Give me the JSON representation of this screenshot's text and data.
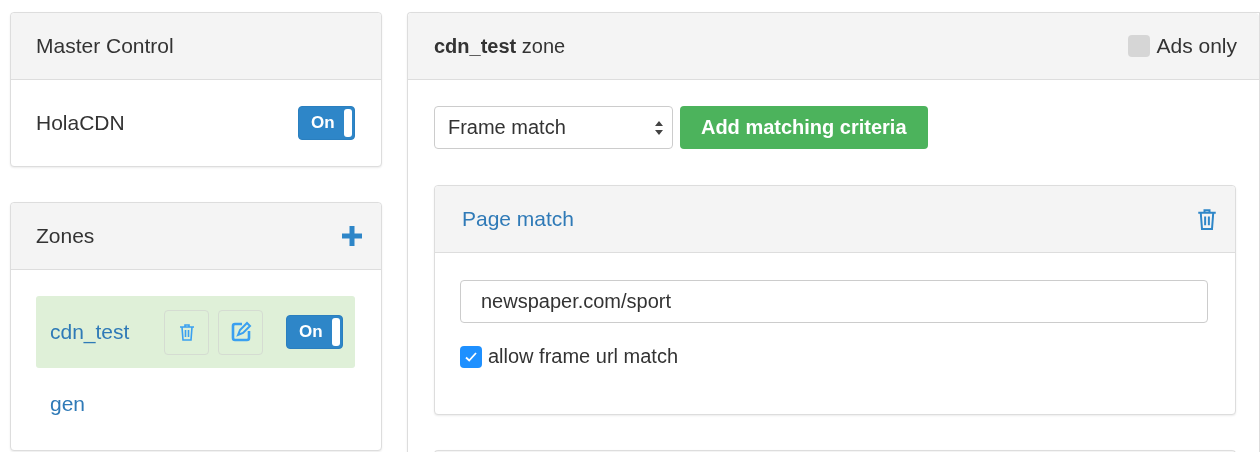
{
  "master_control": {
    "title": "Master Control",
    "items": [
      {
        "label": "HolaCDN",
        "on": true,
        "toggle_label": "On"
      }
    ]
  },
  "zones": {
    "title": "Zones",
    "items": [
      {
        "name": "cdn_test",
        "selected": true,
        "on": true,
        "toggle_label": "On"
      },
      {
        "name": "gen",
        "selected": false
      }
    ]
  },
  "zone_panel": {
    "title": "**cdn_test** zone",
    "ads_only": {
      "label": "Ads only",
      "checked": false
    },
    "criteria_select": {
      "value": "Frame match"
    },
    "add_button": "Add matching criteria",
    "criteria": [
      {
        "title": "Page match",
        "url": "newspaper.com/sport",
        "allow_frame": {
          "label": "allow frame url match",
          "checked": true
        }
      }
    ]
  }
}
